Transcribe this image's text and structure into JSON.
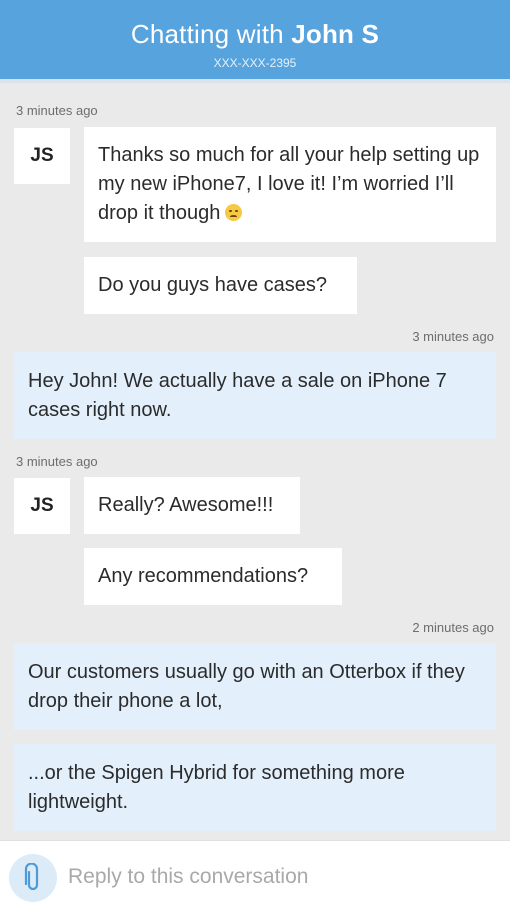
{
  "header": {
    "title_prefix": "Chatting with ",
    "contact_name": "John S",
    "phone": "XXX-XXX-2395"
  },
  "messages": [
    {
      "timestamp": "3 minutes ago",
      "avatar": "JS",
      "bubbles": [
        "Thanks so much for all your help setting up my new iPhone7, I love it! I’m worried I’ll drop it though",
        "Do you guys have cases?"
      ]
    },
    {
      "timestamp": "3 minutes ago",
      "bubbles": [
        "Hey John! We actually have a sale on iPhone 7 cases right now."
      ]
    },
    {
      "timestamp": "3 minutes ago",
      "avatar": "JS",
      "bubbles": [
        "Really? Awesome!!!",
        "Any recommendations?"
      ]
    },
    {
      "timestamp": "2 minutes ago",
      "bubbles": [
        "Our customers usually go with an Otterbox if they drop their phone a lot,",
        "...or the Spigen Hybrid for something more lightweight."
      ]
    }
  ],
  "emoji_icon": "disappointed-face-emoji",
  "reply": {
    "placeholder": "Reply to this conversation",
    "value": "",
    "attach_icon": "paperclip-icon"
  }
}
